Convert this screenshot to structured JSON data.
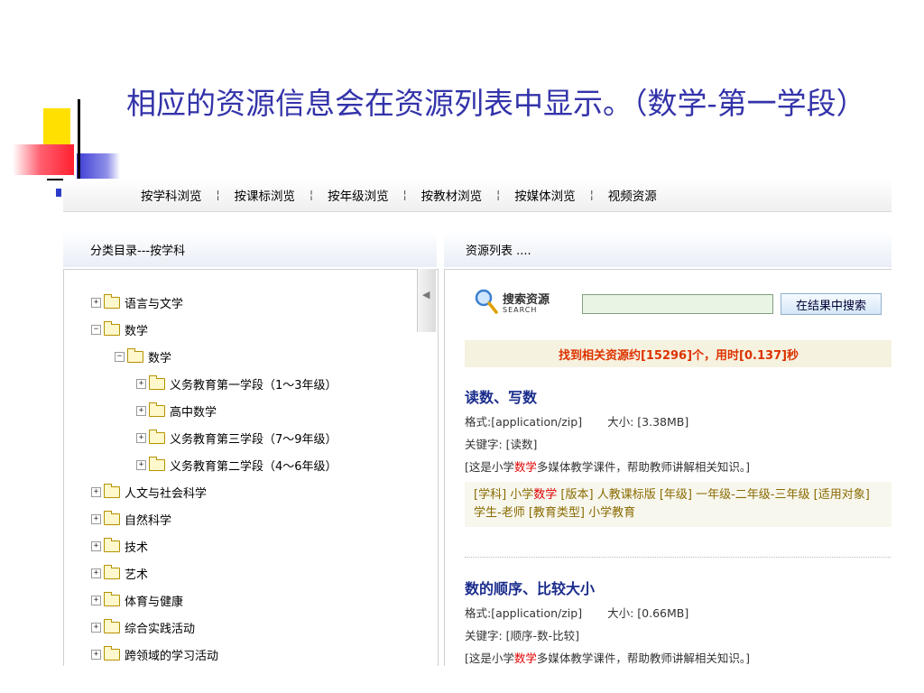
{
  "slide": {
    "title": "相应的资源信息会在资源列表中显示。（数学-第一学段）"
  },
  "nav": {
    "items": [
      "按学科浏览",
      "按课标浏览",
      "按年级浏览",
      "按教材浏览",
      "按媒体浏览",
      "视频资源"
    ],
    "separator": "¦"
  },
  "left_panel": {
    "header": "分类目录---按学科",
    "tree": [
      {
        "label": "语言与文学",
        "toggle": "+"
      },
      {
        "label": "数学",
        "toggle": "−"
      },
      {
        "label": "数学",
        "toggle": "−"
      },
      {
        "label": "义务教育第一学段（1～3年级）",
        "toggle": "+"
      },
      {
        "label": "高中数学",
        "toggle": "+"
      },
      {
        "label": "义务教育第三学段（7～9年级）",
        "toggle": "+"
      },
      {
        "label": "义务教育第二学段（4～6年级）",
        "toggle": "+"
      },
      {
        "label": "人文与社会科学",
        "toggle": "+"
      },
      {
        "label": "自然科学",
        "toggle": "+"
      },
      {
        "label": "技术",
        "toggle": "+"
      },
      {
        "label": "艺术",
        "toggle": "+"
      },
      {
        "label": "体育与健康",
        "toggle": "+"
      },
      {
        "label": "综合实践活动",
        "toggle": "+"
      },
      {
        "label": "跨领域的学习活动",
        "toggle": "+"
      }
    ]
  },
  "right_panel": {
    "header": "资源列表 ....",
    "collapse_arrow": "◀",
    "search": {
      "title": "搜索资源",
      "subtitle": "SEARCH",
      "input_value": "",
      "button_label": "在结果中搜索"
    },
    "summary": "找到相关资源约[15296]个，用时[0.137]秒",
    "results": [
      {
        "title": "读数、写数",
        "format": "格式:[application/zip]",
        "size": "大小: [3.38MB]",
        "keywords": "关键字: [读数]",
        "desc_pre": "[这是小学",
        "desc_hl": "数学",
        "desc_post": "多媒体教学课件，帮助教师讲解相关知识。]",
        "meta_pre": "[学科] 小学",
        "meta_hl": "数学",
        "meta_post": " [版本] 人教课标版 [年级] 一年级-二年级-三年级 [适用对象] 学生-老师 [教育类型] 小学教育"
      },
      {
        "title": "数的顺序、比较大小",
        "format": "格式:[application/zip]",
        "size": "大小: [0.66MB]",
        "keywords": "关键字: [顺序-数-比较]",
        "desc_pre": "[这是小学",
        "desc_hl": "数学",
        "desc_post": "多媒体教学课件，帮助教师讲解相关知识。]"
      }
    ]
  },
  "colors": {
    "title": "#3333aa",
    "result_title": "#1a2c8c",
    "summary_text": "#dd3300",
    "highlight": "#e00000",
    "meta_text": "#8a6a00"
  }
}
